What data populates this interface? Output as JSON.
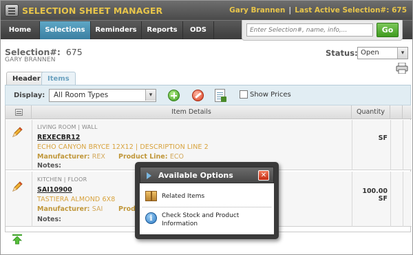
{
  "app": {
    "title": "SELECTION SHEET MANAGER",
    "user_name": "Gary Brannen",
    "last_active_label": "Last Active Selection#: 675"
  },
  "nav": {
    "tabs": [
      {
        "label": "Home"
      },
      {
        "label": "Selections",
        "active": true
      },
      {
        "label": "Reminders"
      },
      {
        "label": "Reports"
      },
      {
        "label": "ODS"
      }
    ]
  },
  "search": {
    "placeholder": "Enter Selection#, name, info,...",
    "button_label": "Go"
  },
  "selection": {
    "label": "Selection#:",
    "number": "675",
    "customer": "GARY BRANNEN",
    "status_label": "Status:",
    "status_value": "Open"
  },
  "subtabs": [
    {
      "label": "Header"
    },
    {
      "label": "Items",
      "active": true
    }
  ],
  "toolbar": {
    "display_label": "Display:",
    "display_value": "All Room Types",
    "show_prices_label": "Show Prices",
    "show_prices_checked": false
  },
  "grid": {
    "columns": [
      "Item Details",
      "Quantity"
    ],
    "rows": [
      {
        "location": "LIVING ROOM | WALL",
        "sku": "REXECBR12",
        "description": "ECHO CANYON BRYCE 12X12 | DESCRIPTION LINE 2",
        "manufacturer_label": "Manufacturer:",
        "manufacturer": "REX",
        "product_line_label": "Product Line:",
        "product_line": "ECO",
        "notes_label": "Notes:",
        "quantity": "SF"
      },
      {
        "location": "KITCHEN | FLOOR",
        "sku": "SAI10900",
        "description": "TASTIERA ALMOND 6X8",
        "manufacturer_label": "Manufacturer:",
        "manufacturer": "SAI",
        "product_line_label": "Produ",
        "notes_label": "Notes:",
        "quantity": "100.00 SF"
      }
    ]
  },
  "popup": {
    "title": "Available Options",
    "items": [
      {
        "label": "Related Items",
        "icon": "box-icon"
      },
      {
        "label": "Check Stock and Product Information",
        "icon": "info-icon"
      }
    ]
  },
  "colors": {
    "accent_blue": "#3a7fa1",
    "title_gold": "#e8c54a",
    "item_text": "#d8a23c"
  }
}
